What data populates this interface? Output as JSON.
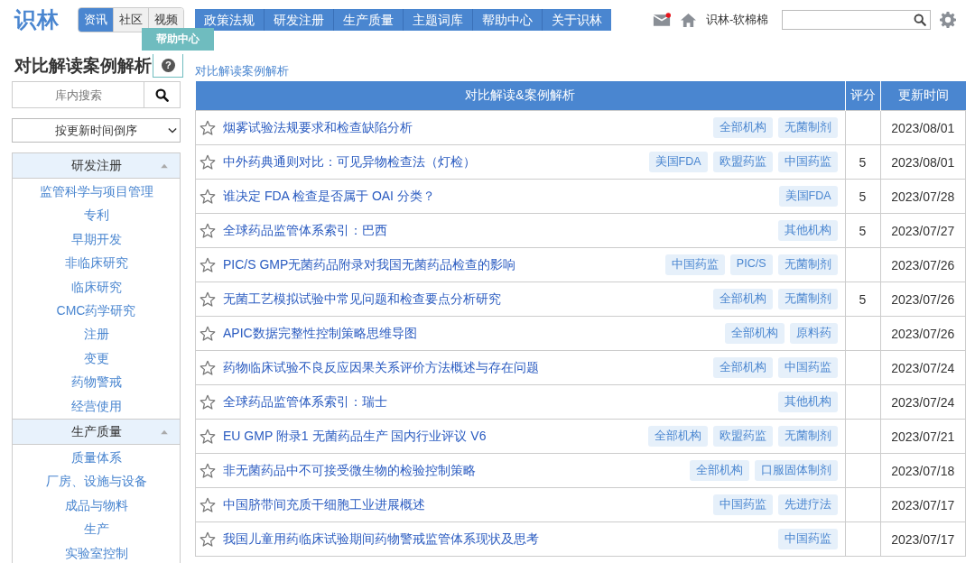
{
  "logo": "识林",
  "channel_tabs": [
    {
      "label": "资讯",
      "selected": true
    },
    {
      "label": "社区",
      "selected": false
    },
    {
      "label": "视频",
      "selected": false
    }
  ],
  "nav": [
    "政策法规",
    "研发注册",
    "生产质量",
    "主题词库",
    "帮助中心",
    "关于识林"
  ],
  "tooltip": "帮助中心",
  "user": {
    "name": "识林-软棉棉",
    "has_notification": true
  },
  "page_title": "对比解读案例解析",
  "help_symbol": "?",
  "breadcrumb": "对比解读案例解析",
  "sidebar": {
    "search_placeholder": "库内搜索",
    "sort": "按更新时间倒序",
    "sections": [
      {
        "title": "研发注册",
        "expanded": true,
        "items": [
          "监管科学与项目管理",
          "专利",
          "早期开发",
          "非临床研究",
          "临床研究",
          "CMC药学研究",
          "注册",
          "变更",
          "药物警戒",
          "经营使用"
        ]
      },
      {
        "title": "生产质量",
        "expanded": true,
        "items": [
          "质量体系",
          "厂房、设施与设备",
          "成品与物料",
          "生产",
          "实验室控制"
        ]
      }
    ]
  },
  "table": {
    "columns": [
      "对比解读&案例解析",
      "评分",
      "更新时间"
    ],
    "rows": [
      {
        "title": "烟雾试验法规要求和检查缺陷分析",
        "tags": [
          "全部机构",
          "无菌制剂"
        ],
        "score": "",
        "date": "2023/08/01"
      },
      {
        "title": "中外药典通则对比：可见异物检查法（灯检）",
        "tags": [
          "美国FDA",
          "欧盟药监",
          "中国药监"
        ],
        "score": "5",
        "date": "2023/08/01"
      },
      {
        "title": "谁决定 FDA 检查是否属于 OAI 分类？",
        "tags": [
          "美国FDA"
        ],
        "score": "5",
        "date": "2023/07/28"
      },
      {
        "title": "全球药品监管体系索引：巴西",
        "tags": [
          "其他机构"
        ],
        "score": "5",
        "date": "2023/07/27"
      },
      {
        "title": "PIC/S GMP无菌药品附录对我国无菌药品检查的影响",
        "tags": [
          "中国药监",
          "PIC/S",
          "无菌制剂"
        ],
        "score": "",
        "date": "2023/07/26"
      },
      {
        "title": "无菌工艺模拟试验中常见问题和检查要点分析研究",
        "tags": [
          "全部机构",
          "无菌制剂"
        ],
        "score": "5",
        "date": "2023/07/26"
      },
      {
        "title": "APIC数据完整性控制策略思维导图",
        "tags": [
          "全部机构",
          "原料药"
        ],
        "score": "",
        "date": "2023/07/26"
      },
      {
        "title": "药物临床试验不良反应因果关系评价方法概述与存在问题",
        "tags": [
          "全部机构",
          "中国药监"
        ],
        "score": "",
        "date": "2023/07/24"
      },
      {
        "title": "全球药品监管体系索引：瑞士",
        "tags": [
          "其他机构"
        ],
        "score": "",
        "date": "2023/07/24"
      },
      {
        "title": "EU GMP 附录1 无菌药品生产 国内行业评议 V6",
        "tags": [
          "全部机构",
          "欧盟药监",
          "无菌制剂"
        ],
        "score": "",
        "date": "2023/07/21"
      },
      {
        "title": "非无菌药品中不可接受微生物的检验控制策略",
        "tags": [
          "全部机构",
          "口服固体制剂"
        ],
        "score": "",
        "date": "2023/07/18"
      },
      {
        "title": "中国脐带间充质干细胞工业进展概述",
        "tags": [
          "中国药监",
          "先进疗法"
        ],
        "score": "",
        "date": "2023/07/17"
      },
      {
        "title": "我国儿童用药临床试验期间药物警戒监管体系现状及思考",
        "tags": [
          "中国药监"
        ],
        "score": "",
        "date": "2023/07/17"
      }
    ]
  }
}
